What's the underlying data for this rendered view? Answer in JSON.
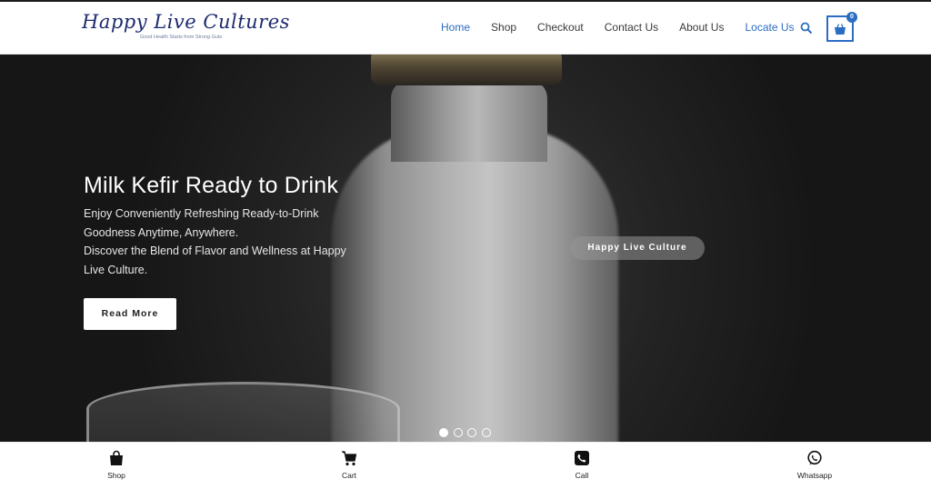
{
  "brand": {
    "name": "Happy Live Cultures",
    "tagline": "Good Health Starts from Strong Guts"
  },
  "nav": {
    "items": [
      {
        "label": "Home",
        "state": "active"
      },
      {
        "label": "Shop",
        "state": "normal"
      },
      {
        "label": "Checkout",
        "state": "normal"
      },
      {
        "label": "Contact Us",
        "state": "normal"
      },
      {
        "label": "About Us",
        "state": "normal"
      },
      {
        "label": "Locate Us",
        "state": "accent"
      }
    ],
    "search_icon": "search-icon",
    "cart_count": "0"
  },
  "hero": {
    "title": "Milk Kefir Ready to Drink",
    "line1": "Enjoy Conveniently Refreshing Ready-to-Drink Goodness Anytime, Anywhere.",
    "line2": "Discover the Blend of Flavor and Wellness at Happy Live Culture.",
    "button_label": "Read More",
    "pill_label": "Happy Live Culture",
    "slides": [
      true,
      false,
      false,
      false
    ]
  },
  "bottombar": {
    "items": [
      {
        "label": "Shop",
        "icon": "shopping-bag-icon"
      },
      {
        "label": "Cart",
        "icon": "cart-icon"
      },
      {
        "label": "Call",
        "icon": "phone-icon"
      },
      {
        "label": "Whatsapp",
        "icon": "whatsapp-icon"
      }
    ]
  },
  "colors": {
    "accent": "#2b6dc2",
    "brand": "#1c2a6e"
  }
}
